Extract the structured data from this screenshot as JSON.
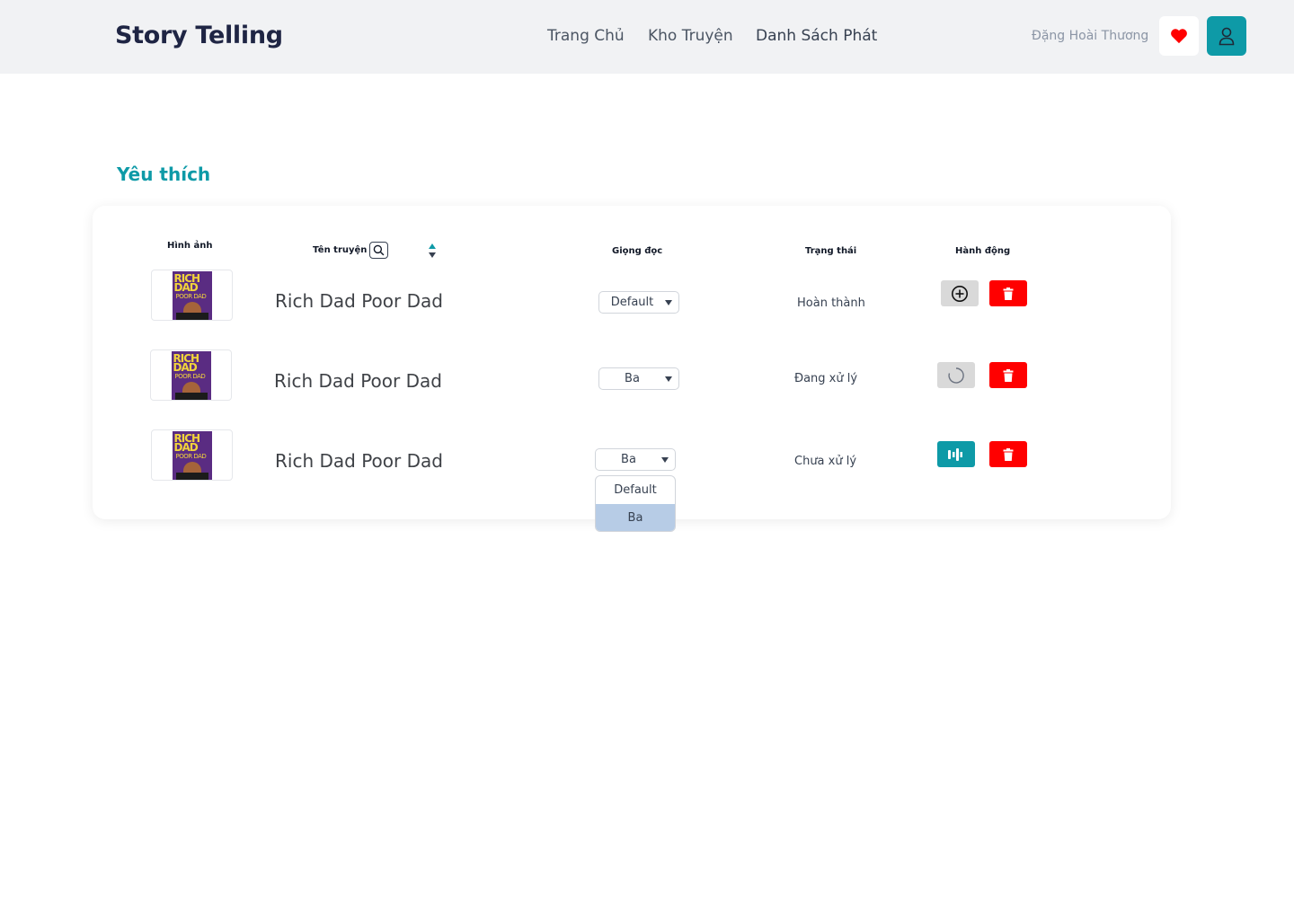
{
  "header": {
    "brand": "Story Telling",
    "nav": [
      {
        "label": "Trang Chủ"
      },
      {
        "label": "Kho Truyện"
      },
      {
        "label": "Danh Sách Phát"
      }
    ],
    "username": "Đặng Hoài Thương",
    "favorite_icon": "heart-icon",
    "user_icon": "user-icon"
  },
  "page": {
    "title": "Yêu thích"
  },
  "table": {
    "headers": {
      "image": "Hình ảnh",
      "name": "Tên truyện",
      "voice": "Giọng đọc",
      "status": "Trạng thái",
      "action": "Hành động"
    },
    "rows": [
      {
        "cover_title_1": "RICH",
        "cover_title_2": "DAD",
        "cover_sub": "POOR DAD",
        "name": "Rich Dad Poor Dad",
        "voice": "Default",
        "status": "Hoàn thành",
        "action_icon": "add-circle-icon"
      },
      {
        "cover_title_1": "RICH",
        "cover_title_2": "DAD",
        "cover_sub": "POOR DAD",
        "name": "Rich Dad Poor Dad",
        "voice": "Ba",
        "status": "Đang xử lý",
        "action_icon": "spinner-icon"
      },
      {
        "cover_title_1": "RICH",
        "cover_title_2": "DAD",
        "cover_sub": "POOR DAD",
        "name": "Rich Dad Poor Dad",
        "voice": "Ba",
        "status": "Chưa xử lý",
        "action_icon": "audio-settings-icon"
      }
    ],
    "voice_options": [
      "Default",
      "Ba"
    ],
    "voice_selected": "Ba"
  },
  "colors": {
    "accent": "#0e9aa7",
    "danger": "#ff0000",
    "header_bg": "#f1f2f4",
    "selected_option": "#b7cce6"
  }
}
